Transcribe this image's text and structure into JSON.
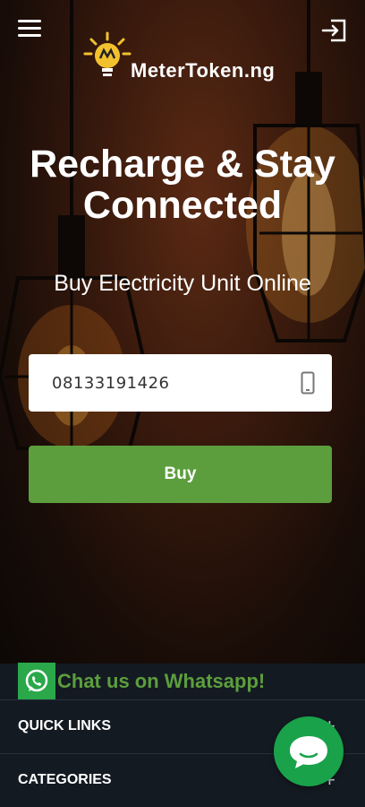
{
  "header": {
    "brand": "MeterToken.ng"
  },
  "hero": {
    "title": "Recharge & Stay Connected",
    "subtitle": "Buy Electricity Unit Online",
    "phone_value": "08133191426",
    "buy_label": "Buy"
  },
  "footer": {
    "whatsapp_label": "Chat us on Whatsapp!",
    "quick_links_label": "QUICK LINKS",
    "categories_label": "CATEGORIES",
    "expand_symbol": "+"
  },
  "icons": {
    "menu": "hamburger-icon",
    "login": "login-icon",
    "phone": "mobile-phone-icon",
    "whatsapp": "whatsapp-icon",
    "chat": "chat-bubble-icon"
  },
  "colors": {
    "accent_green": "#5c9e3d",
    "whatsapp_green": "#2aa84a",
    "chat_green": "#19a24a",
    "footer_bg": "#141a22"
  }
}
